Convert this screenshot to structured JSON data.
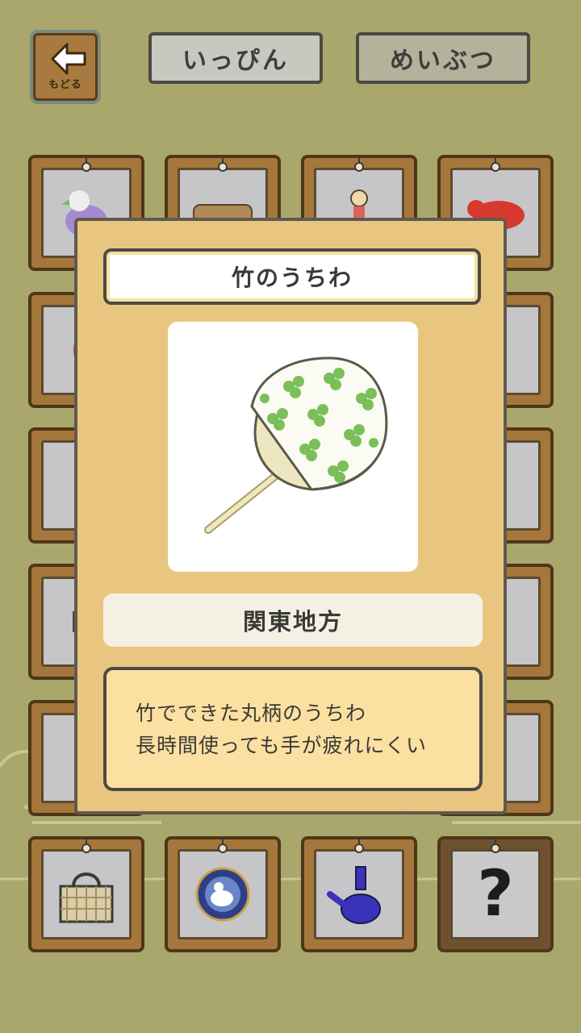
{
  "nav": {
    "back_label": "もどる",
    "tabs": [
      {
        "label": "いっぴん"
      },
      {
        "label": "めいぶつ"
      }
    ]
  },
  "grid": {
    "items": [
      {
        "icon": "pigeon-whistle-icon"
      },
      {
        "icon": "sandals-icon"
      },
      {
        "icon": "kokeshi-doll-icon"
      },
      {
        "icon": "red-cow-icon"
      },
      {
        "icon": "daruma-icon"
      },
      {
        "icon": "comb-icon"
      },
      {
        "icon": "shamisen-icon"
      },
      {
        "icon": "folding-fan-icon"
      },
      {
        "icon": "box-icon"
      },
      {
        "icon": "red-doll-icon"
      },
      {
        "icon": "scissors-icon"
      },
      {
        "icon": "round-fan-icon"
      },
      {
        "icon": "woven-basket-icon"
      },
      {
        "icon": "rabbit-plate-icon"
      },
      {
        "icon": "blue-teapot-icon"
      },
      {
        "icon": "question-mark-icon",
        "label": "?"
      }
    ]
  },
  "dialog": {
    "title": "竹のうちわ",
    "image_icon": "bamboo-round-fan-icon",
    "region": "関東地方",
    "description_lines": [
      "竹でできた丸柄のうちわ",
      "長時間使っても手が疲れにくい"
    ]
  },
  "colors": {
    "background": "#a9a76c",
    "card_wood": "#a6773c",
    "dialog_bg": "#e9c680",
    "fan_green": "#7bbf5a"
  }
}
